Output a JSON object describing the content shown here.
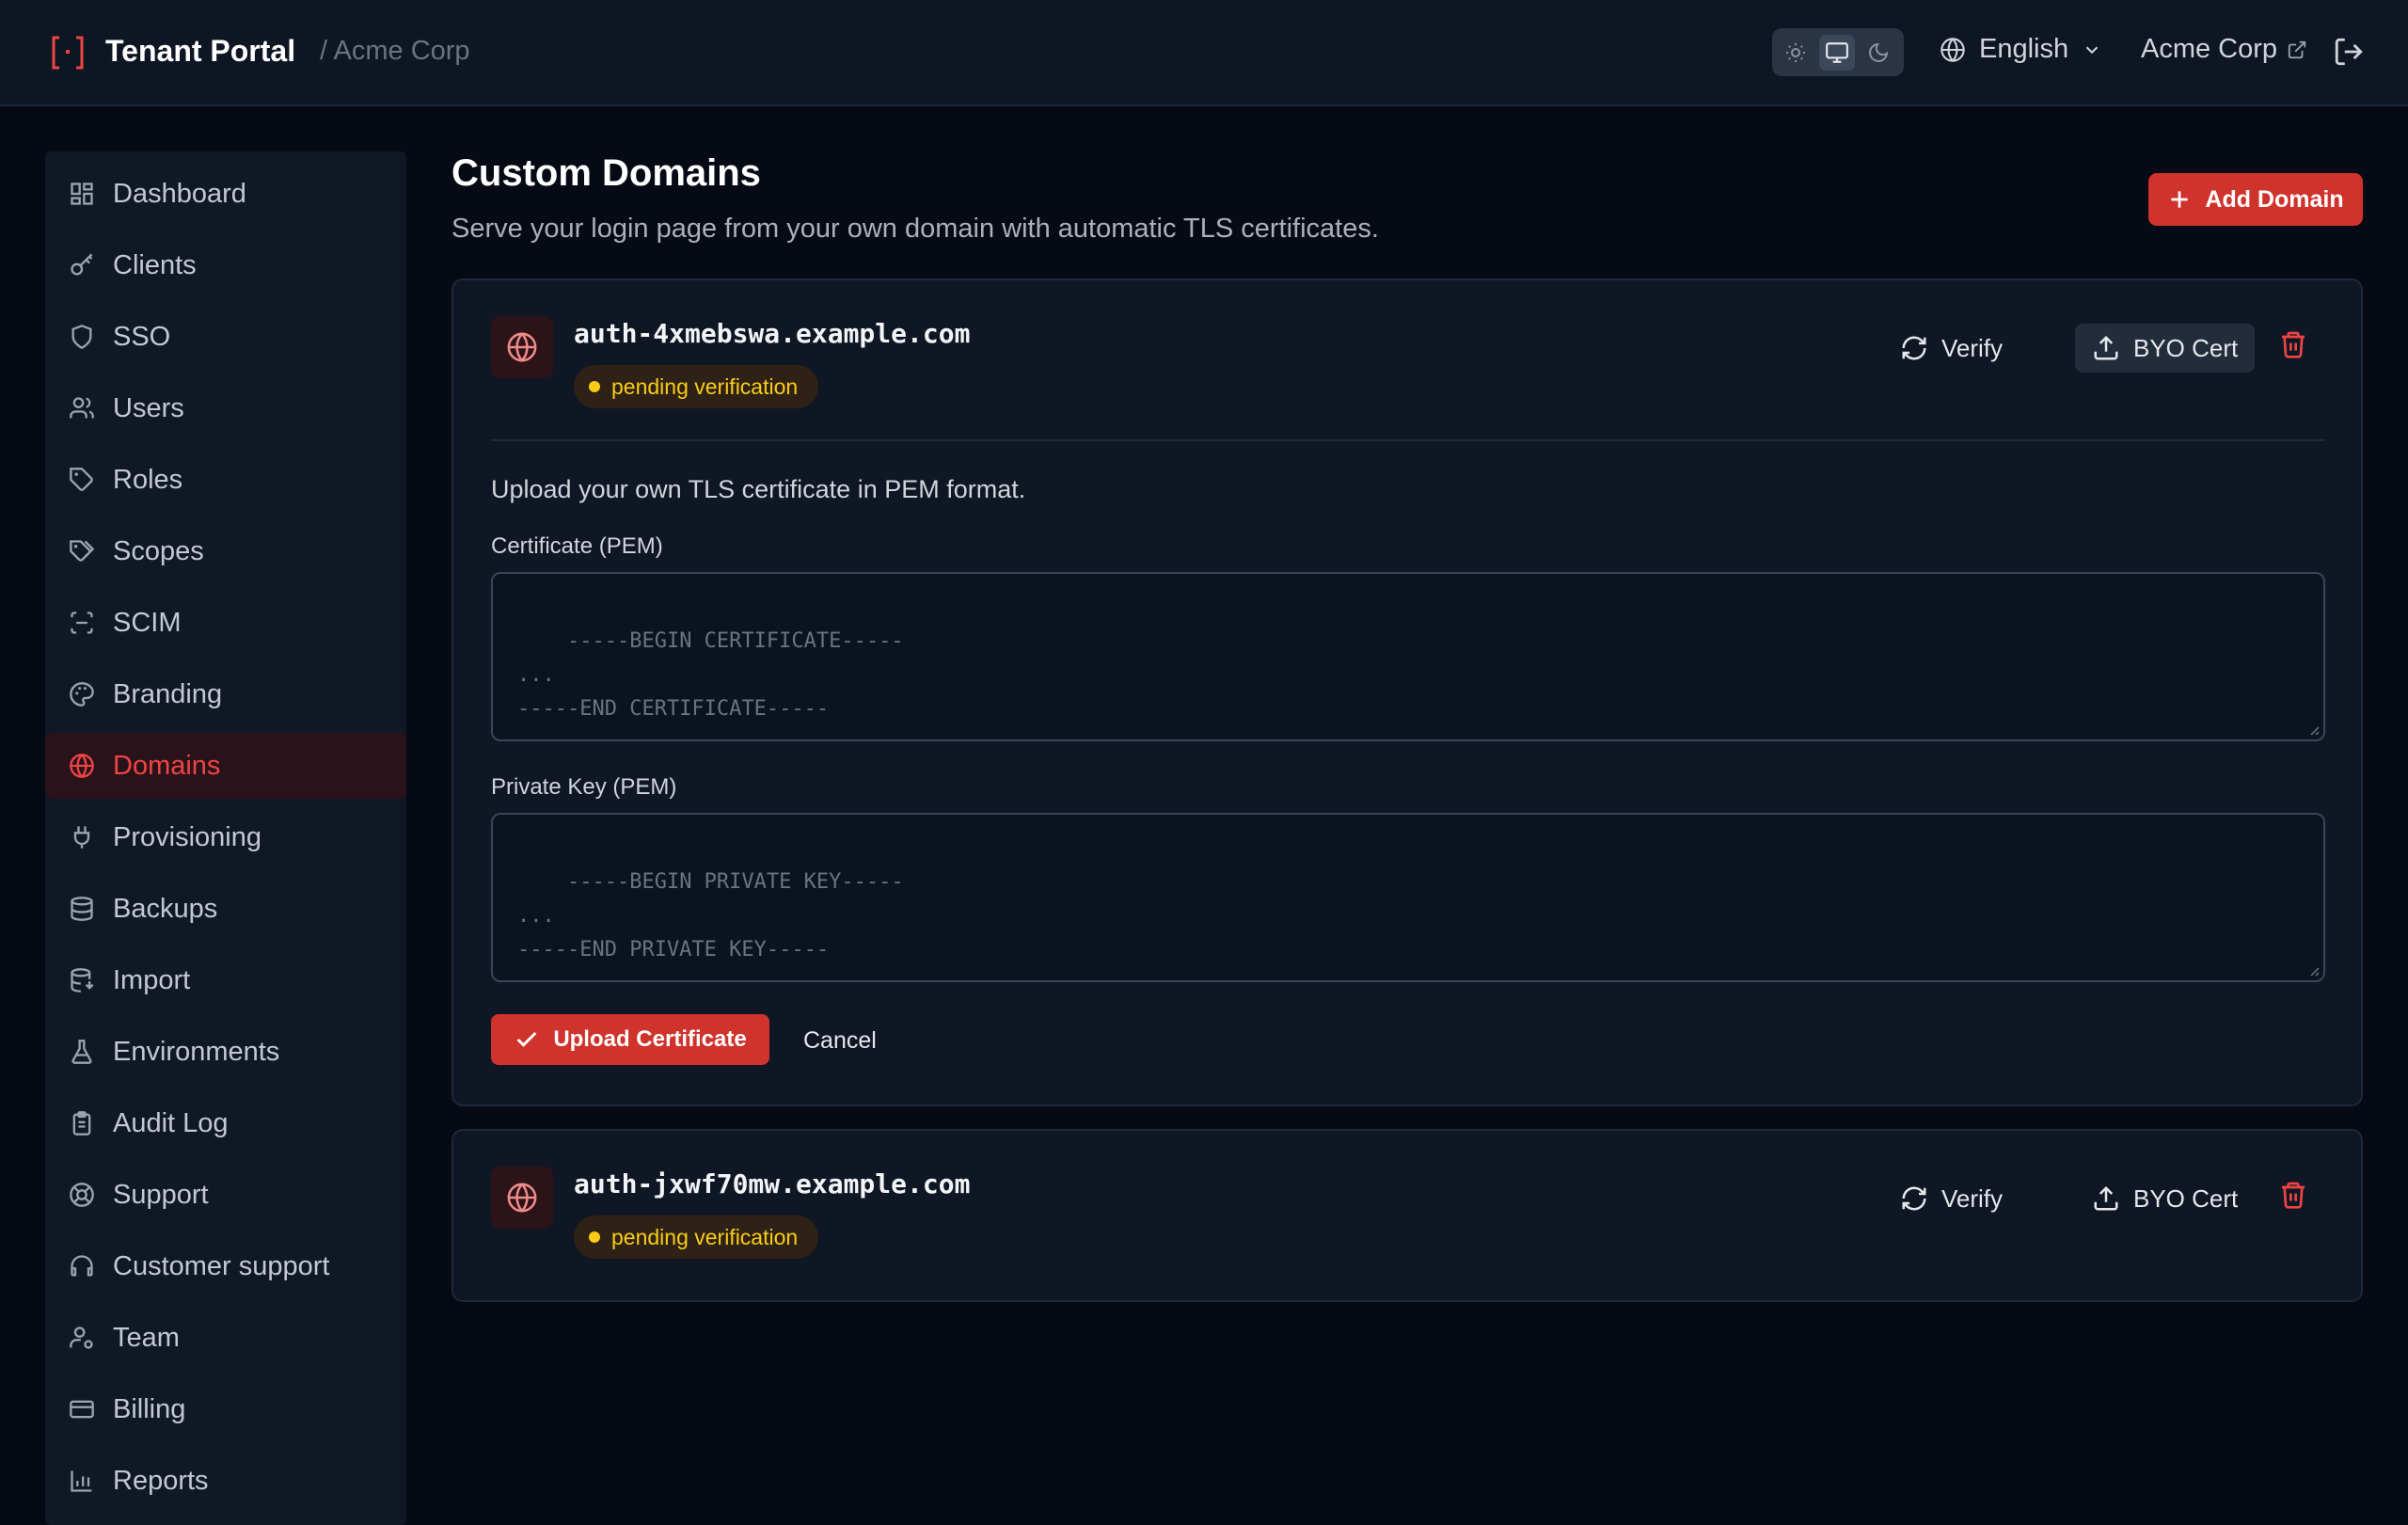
{
  "header": {
    "title": "Tenant Portal",
    "breadcrumb": "/ Acme Corp",
    "language": "English",
    "org_link": "Acme Corp"
  },
  "sidebar": {
    "items": [
      {
        "label": "Dashboard",
        "icon": "dashboard-icon"
      },
      {
        "label": "Clients",
        "icon": "key-icon"
      },
      {
        "label": "SSO",
        "icon": "shield-icon"
      },
      {
        "label": "Users",
        "icon": "users-icon"
      },
      {
        "label": "Roles",
        "icon": "tag-icon"
      },
      {
        "label": "Scopes",
        "icon": "tags-icon"
      },
      {
        "label": "SCIM",
        "icon": "scan-icon"
      },
      {
        "label": "Branding",
        "icon": "palette-icon"
      },
      {
        "label": "Domains",
        "icon": "globe-icon"
      },
      {
        "label": "Provisioning",
        "icon": "plug-icon"
      },
      {
        "label": "Backups",
        "icon": "database-icon"
      },
      {
        "label": "Import",
        "icon": "database-import-icon"
      },
      {
        "label": "Environments",
        "icon": "flask-icon"
      },
      {
        "label": "Audit Log",
        "icon": "clipboard-icon"
      },
      {
        "label": "Support",
        "icon": "lifebuoy-icon"
      },
      {
        "label": "Customer support",
        "icon": "headset-icon"
      },
      {
        "label": "Team",
        "icon": "user-cog-icon"
      },
      {
        "label": "Billing",
        "icon": "credit-card-icon"
      },
      {
        "label": "Reports",
        "icon": "bar-chart-icon"
      }
    ],
    "active": "Domains"
  },
  "main": {
    "title": "Custom Domains",
    "description": "Serve your login page from your own domain with automatic TLS certificates.",
    "add_button": "Add Domain"
  },
  "domains": [
    {
      "name": "auth-4xmebswa.example.com",
      "status": "pending verification",
      "verify_label": "Verify",
      "byo_label": "BYO Cert",
      "expanded": true,
      "upload_hint": "Upload your own TLS certificate in PEM format.",
      "cert_label": "Certificate (PEM)",
      "cert_placeholder": "-----BEGIN CERTIFICATE-----\n...\n-----END CERTIFICATE-----",
      "key_label": "Private Key (PEM)",
      "key_placeholder": "-----BEGIN PRIVATE KEY-----\n...\n-----END PRIVATE KEY-----",
      "upload_button": "Upload Certificate",
      "cancel_button": "Cancel"
    },
    {
      "name": "auth-jxwf70mw.example.com",
      "status": "pending verification",
      "verify_label": "Verify",
      "byo_label": "BYO Cert",
      "expanded": false
    }
  ],
  "colors": {
    "accent": "#d0332c",
    "pending": "#facc15",
    "background": "#060a14",
    "surface": "#0f1725"
  }
}
